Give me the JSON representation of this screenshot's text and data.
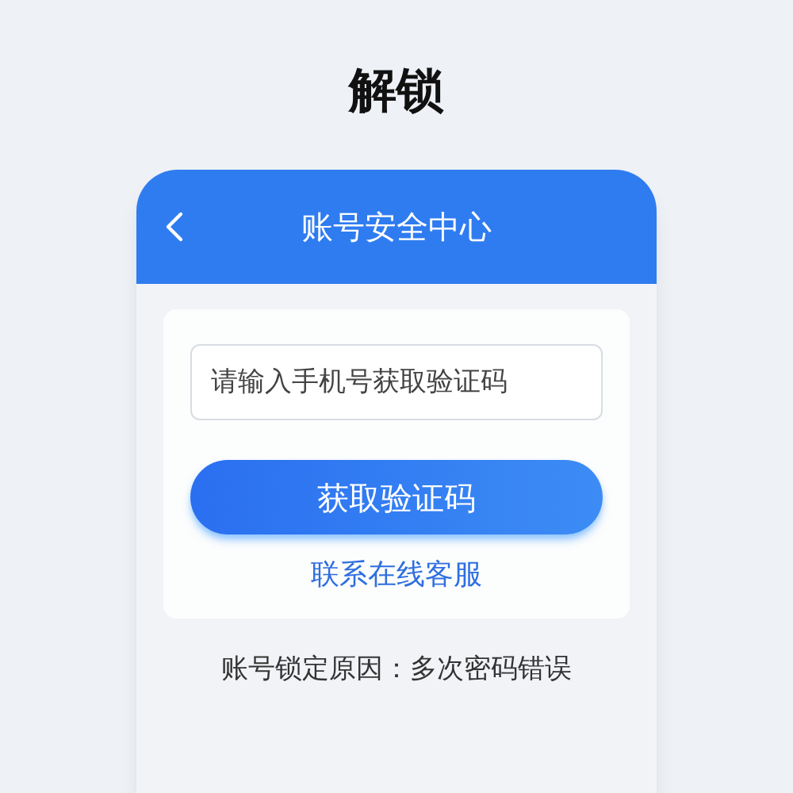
{
  "page_title": "解锁",
  "card": {
    "header_title": "账号安全中心",
    "phone_field": {
      "placeholder": "请输入手机号获取验证码"
    },
    "submit_button": "获取验证码",
    "support_link": "联系在线客服",
    "lock_reason": "账号锁定原因：多次密码错误"
  }
}
